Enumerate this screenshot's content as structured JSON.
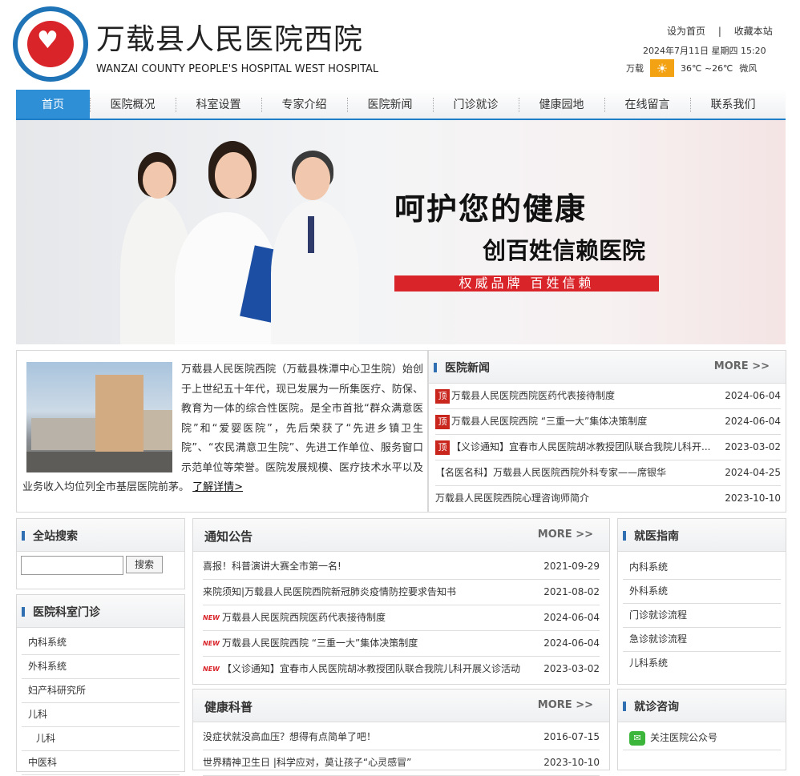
{
  "header": {
    "site_name_cn": "万载县人民医院西院",
    "site_name_en": "WANZAI COUNTY PEOPLE'S HOSPITAL WEST HOSPITAL",
    "set_home": "设为首页",
    "separator": "|",
    "bookmark": "收藏本站",
    "datetime": "2024年7月11日  星期四  15:20",
    "weather_city": "万载",
    "weather_temp": "36℃ ~26℃",
    "weather_wind": "微风",
    "weather_icon": "sun-icon"
  },
  "nav": {
    "items": [
      {
        "label": "首页"
      },
      {
        "label": "医院概况"
      },
      {
        "label": "科室设置"
      },
      {
        "label": "专家介绍"
      },
      {
        "label": "医院新闻"
      },
      {
        "label": "门诊就诊"
      },
      {
        "label": "健康园地"
      },
      {
        "label": "在线留言"
      },
      {
        "label": "联系我们"
      }
    ]
  },
  "banner": {
    "slogan_main": "呵护您的健康",
    "slogan_sub": "创百姓信赖医院",
    "slogan_bar": "权威品牌  百姓信赖"
  },
  "about": {
    "text": "万载县人民医院西院（万载县株潭中心卫生院）始创于上世纪五十年代，现已发展为一所集医疗、防保、教育为一体的综合性医院。是全市首批“群众满意医院”和“爱婴医院”，先后荣获了“先进乡镇卫生院”、“农民满意卫生院”、先进工作单位、服务窗口示范单位等荣誉。医院发展规模、医疗技术水平以及业务收入均位列全市基层医院前茅。",
    "link": "了解详情>"
  },
  "hospital_news": {
    "title": "医院新闻",
    "more": "MORE >>",
    "tag": "顶",
    "items": [
      {
        "title": "万载县人民医院西院医药代表接待制度",
        "date": "2024-06-04",
        "top": true
      },
      {
        "title": "万载县人民医院西院 “三重一大”集体决策制度",
        "date": "2024-06-04",
        "top": true
      },
      {
        "title": "【义诊通知】宜春市人民医院胡冰教授团队联合我院儿科开...",
        "date": "2023-03-02",
        "top": true
      },
      {
        "title": "【名医名科】万载县人民医院西院外科专家——席银华",
        "date": "2024-04-25",
        "top": false
      },
      {
        "title": "万载县人民医院西院心理咨询师简介",
        "date": "2023-10-10",
        "top": false
      }
    ]
  },
  "search": {
    "title": "全站搜索",
    "button": "搜索",
    "value": ""
  },
  "departments": {
    "title": "医院科室门诊",
    "items": [
      "内科系统",
      "外科系统",
      "妇产科研究所",
      "儿科",
      "儿科",
      "中医科"
    ]
  },
  "notices": {
    "title": "通知公告",
    "more": "MORE >>",
    "new_tag": "NEW",
    "items": [
      {
        "title": "喜报！科普演讲大赛全市第一名!",
        "date": "2021-09-29",
        "new": false
      },
      {
        "title": "来院须知|万载县人民医院西院新冠肺炎疫情防控要求告知书",
        "date": "2021-08-02",
        "new": false
      },
      {
        "title": "万载县人民医院西院医药代表接待制度",
        "date": "2024-06-04",
        "new": true
      },
      {
        "title": "万载县人民医院西院 “三重一大”集体决策制度",
        "date": "2024-06-04",
        "new": true
      },
      {
        "title": "【义诊通知】宜春市人民医院胡冰教授团队联合我院儿科开展义诊活动",
        "date": "2023-03-02",
        "new": true
      }
    ]
  },
  "health": {
    "title": "健康科普",
    "more": "MORE >>",
    "items": [
      {
        "title": "没症状就没高血压？想得有点简单了吧！",
        "date": "2016-07-15"
      },
      {
        "title": "世界精神卫生日 |科学应对，莫让孩子“心灵感冒”",
        "date": "2023-10-10"
      }
    ]
  },
  "guide": {
    "title": "就医指南",
    "items": [
      "内科系统",
      "外科系统",
      "门诊就诊流程",
      "急诊就诊流程",
      "儿科系统"
    ]
  },
  "consult": {
    "title": "就诊咨询",
    "wechat_label": "关注医院公众号",
    "icon": "wechat-icon"
  },
  "colors": {
    "nav_active": "#2f8fd6",
    "accent_red": "#d9242a",
    "accent_blue": "#1e7fc8"
  }
}
